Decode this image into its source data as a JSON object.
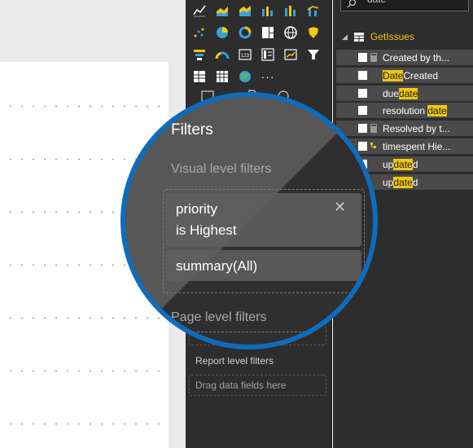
{
  "visualizations": {
    "icons": [
      "line-chart-icon",
      "area-chart-icon",
      "stacked-area-chart-icon",
      "ribbon-chart-icon",
      "waterfall-chart-icon",
      "line-clustered-column-icon",
      "scatter-chart-icon",
      "pie-chart-icon",
      "donut-chart-icon",
      "treemap-icon",
      "globe-map-icon",
      "filled-map-icon",
      "funnel-icon",
      "gauge-icon",
      "card-icon",
      "multi-row-card-icon",
      "kpi-icon",
      "slicer-icon",
      "table-icon",
      "matrix-icon",
      "arcgis-map-icon"
    ],
    "more_label": "···"
  },
  "filters": {
    "header": "Filters",
    "visual_level": "Visual level filters",
    "filter1_field": "priority",
    "filter1_condition": "is Highest",
    "filter2": "summary(All)",
    "page_level": "Page level filters",
    "report_level": "Report level filters",
    "drop_placeholder": "Drag data fields here"
  },
  "fields": {
    "search_value": "date",
    "table_name": "GetIssues",
    "items": [
      {
        "prefix": "Created by th...",
        "match": "",
        "suffix": "",
        "checked": false,
        "icon": "calc-icon"
      },
      {
        "prefix": "",
        "match": "Date",
        "suffix": "Created",
        "checked": false,
        "icon": ""
      },
      {
        "prefix": "due",
        "match": "date",
        "suffix": "",
        "checked": false,
        "icon": ""
      },
      {
        "prefix": "resolution ",
        "match": "date",
        "suffix": "",
        "checked": false,
        "icon": ""
      },
      {
        "prefix": "Resolved by t...",
        "match": "",
        "suffix": "",
        "checked": false,
        "icon": "calc-icon"
      },
      {
        "prefix": "timespent Hie...",
        "match": "",
        "suffix": "",
        "checked": false,
        "icon": "hierarchy-icon"
      },
      {
        "prefix": "up",
        "match": "date",
        "suffix": "d",
        "checked": false,
        "icon": ""
      },
      {
        "prefix": "up",
        "match": "date",
        "suffix": "d",
        "checked": false,
        "icon": ""
      }
    ]
  },
  "colors": {
    "accent": "#f2c811",
    "lens_border": "#0f6cbd",
    "pane_bg": "#2d2d2d"
  }
}
